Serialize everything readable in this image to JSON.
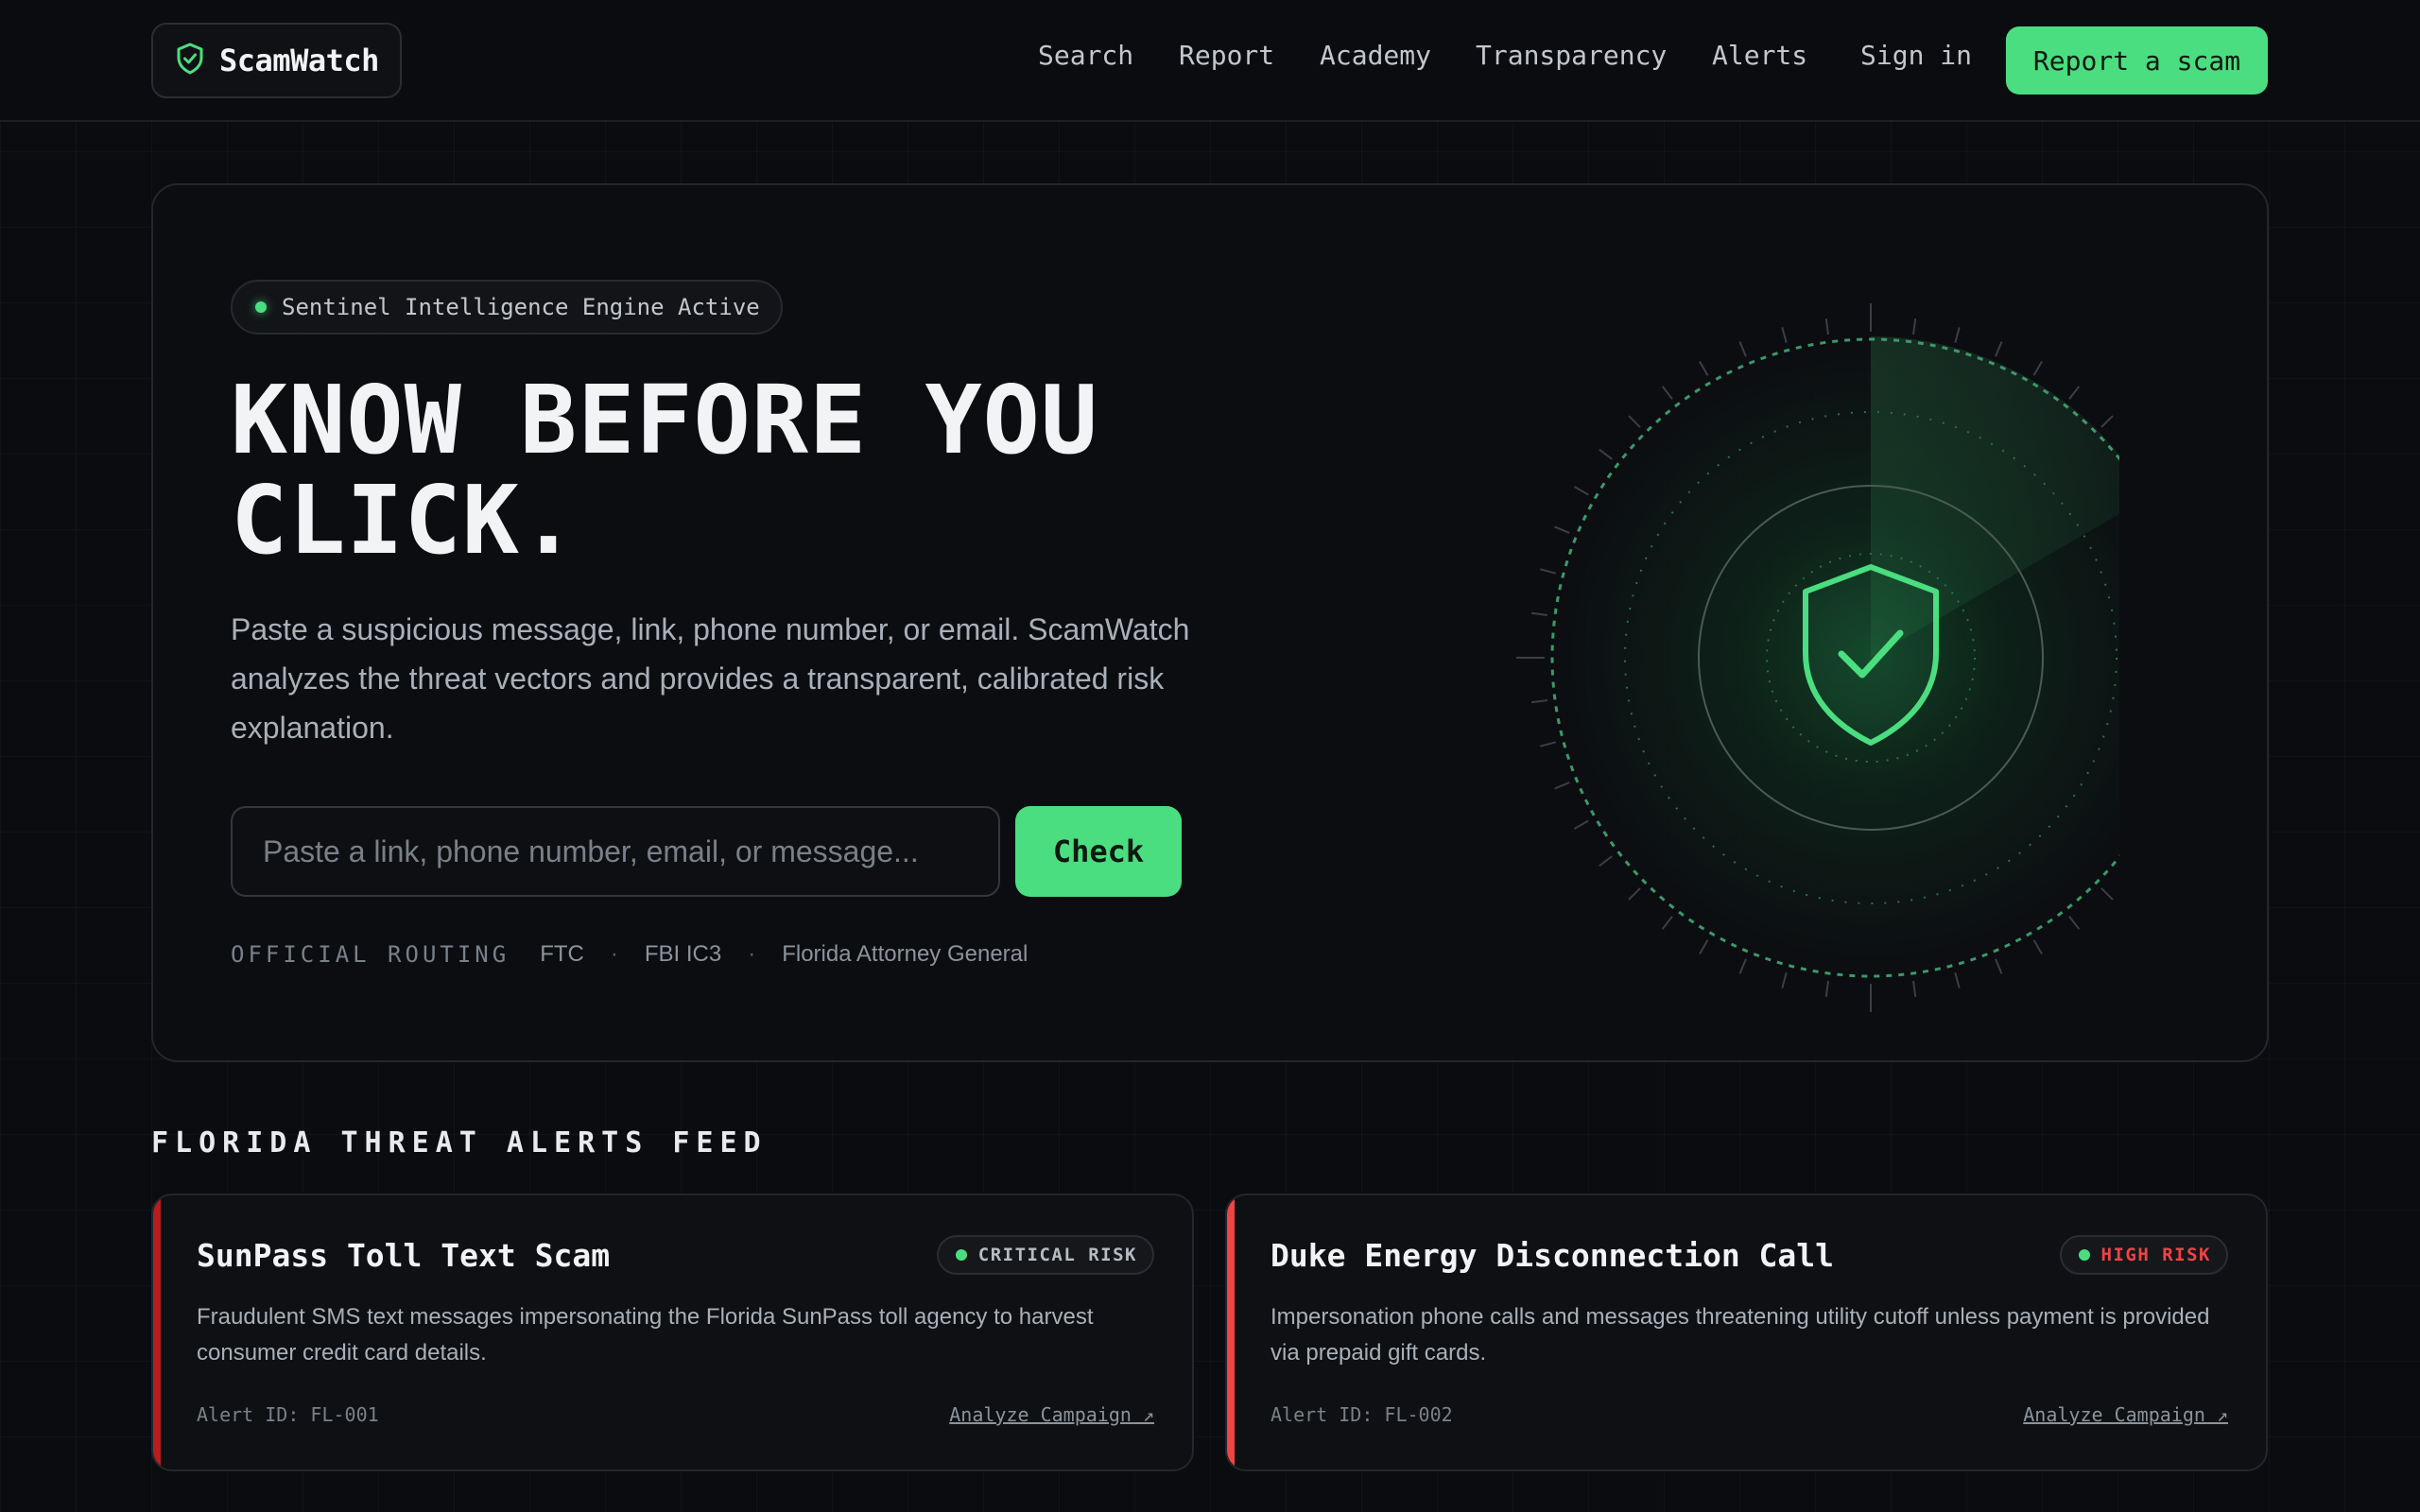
{
  "header": {
    "logo_text": "ScamWatch",
    "logo_icon": "shield-check-icon",
    "nav": [
      {
        "label": "Search"
      },
      {
        "label": "Report"
      },
      {
        "label": "Academy"
      },
      {
        "label": "Transparency"
      },
      {
        "label": "Alerts"
      }
    ],
    "sign_in": "Sign in",
    "cta": "Report a scam"
  },
  "hero": {
    "status": "Sentinel Intelligence Engine Active",
    "headline_line1": "KNOW BEFORE YOU",
    "headline_line2": "CLICK.",
    "subtext": "Paste a suspicious message, link, phone number, or email. ScamWatch analyzes the threat vectors and provides a transparent, calibrated risk explanation.",
    "search_placeholder": "Paste a link, phone number, email, or message...",
    "search_value": "",
    "check_label": "Check",
    "routing_label": "OFFICIAL ROUTING",
    "routing_items": [
      "FTC",
      "FBI IC3",
      "Florida Attorney General"
    ],
    "routing_separator": "·",
    "radar_icon": "shield-check-icon"
  },
  "feed": {
    "title": "FLORIDA THREAT ALERTS FEED",
    "alerts": [
      {
        "title": "SunPass Toll Text Scam",
        "risk": "CRITICAL RISK",
        "description": "Fraudulent SMS text messages impersonating the Florida SunPass toll agency to harvest consumer credit card details.",
        "alert_id": "Alert ID: FL-001",
        "link": "Analyze Campaign ↗"
      },
      {
        "title": "Duke Energy Disconnection Call",
        "risk": "HIGH RISK",
        "description": "Impersonation phone calls and messages threatening utility cutoff unless payment is provided via prepaid gift cards.",
        "alert_id": "Alert ID: FL-002",
        "link": "Analyze Campaign ↗"
      }
    ]
  },
  "colors": {
    "accent": "#4ade80",
    "background": "#0b0c0f",
    "critical": "#b91c1c",
    "high": "#ef4444",
    "critical_text": "#b7bcc3",
    "high_text": "#ef4444"
  }
}
